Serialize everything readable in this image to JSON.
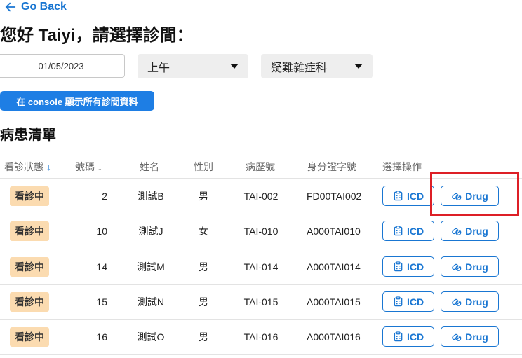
{
  "nav": {
    "back_label": "Go Back"
  },
  "header": {
    "greeting": "您好 Taiyi，請選擇診間："
  },
  "filters": {
    "date_value": "01/05/2023",
    "time_value": "上午",
    "department_value": "疑難雜症科"
  },
  "console_button_label": "在 console 顯示所有診間資料",
  "section_title": "病患清單",
  "table": {
    "headers": {
      "status": "看診狀態",
      "number": "號碼",
      "name": "姓名",
      "gender": "性別",
      "record_no": "病歷號",
      "id_no": "身分證字號",
      "actions": "選擇操作"
    },
    "sort_arrow": "↓",
    "icd_label": "ICD",
    "drug_label": "Drug",
    "rows": [
      {
        "status": "看診中",
        "number": "2",
        "name": "測試B",
        "gender": "男",
        "record_no": "TAI-002",
        "id_no": "FD00TAI002"
      },
      {
        "status": "看診中",
        "number": "10",
        "name": "測試J",
        "gender": "女",
        "record_no": "TAI-010",
        "id_no": "A000TAI010"
      },
      {
        "status": "看診中",
        "number": "14",
        "name": "測試M",
        "gender": "男",
        "record_no": "TAI-014",
        "id_no": "A000TAI014"
      },
      {
        "status": "看診中",
        "number": "15",
        "name": "測試N",
        "gender": "男",
        "record_no": "TAI-015",
        "id_no": "A000TAI015"
      },
      {
        "status": "看診中",
        "number": "16",
        "name": "測試O",
        "gender": "男",
        "record_no": "TAI-016",
        "id_no": "A000TAI016"
      }
    ]
  },
  "colors": {
    "accent": "#1976d2",
    "badge": "#fbdbb0",
    "highlight": "#dd1f26"
  }
}
